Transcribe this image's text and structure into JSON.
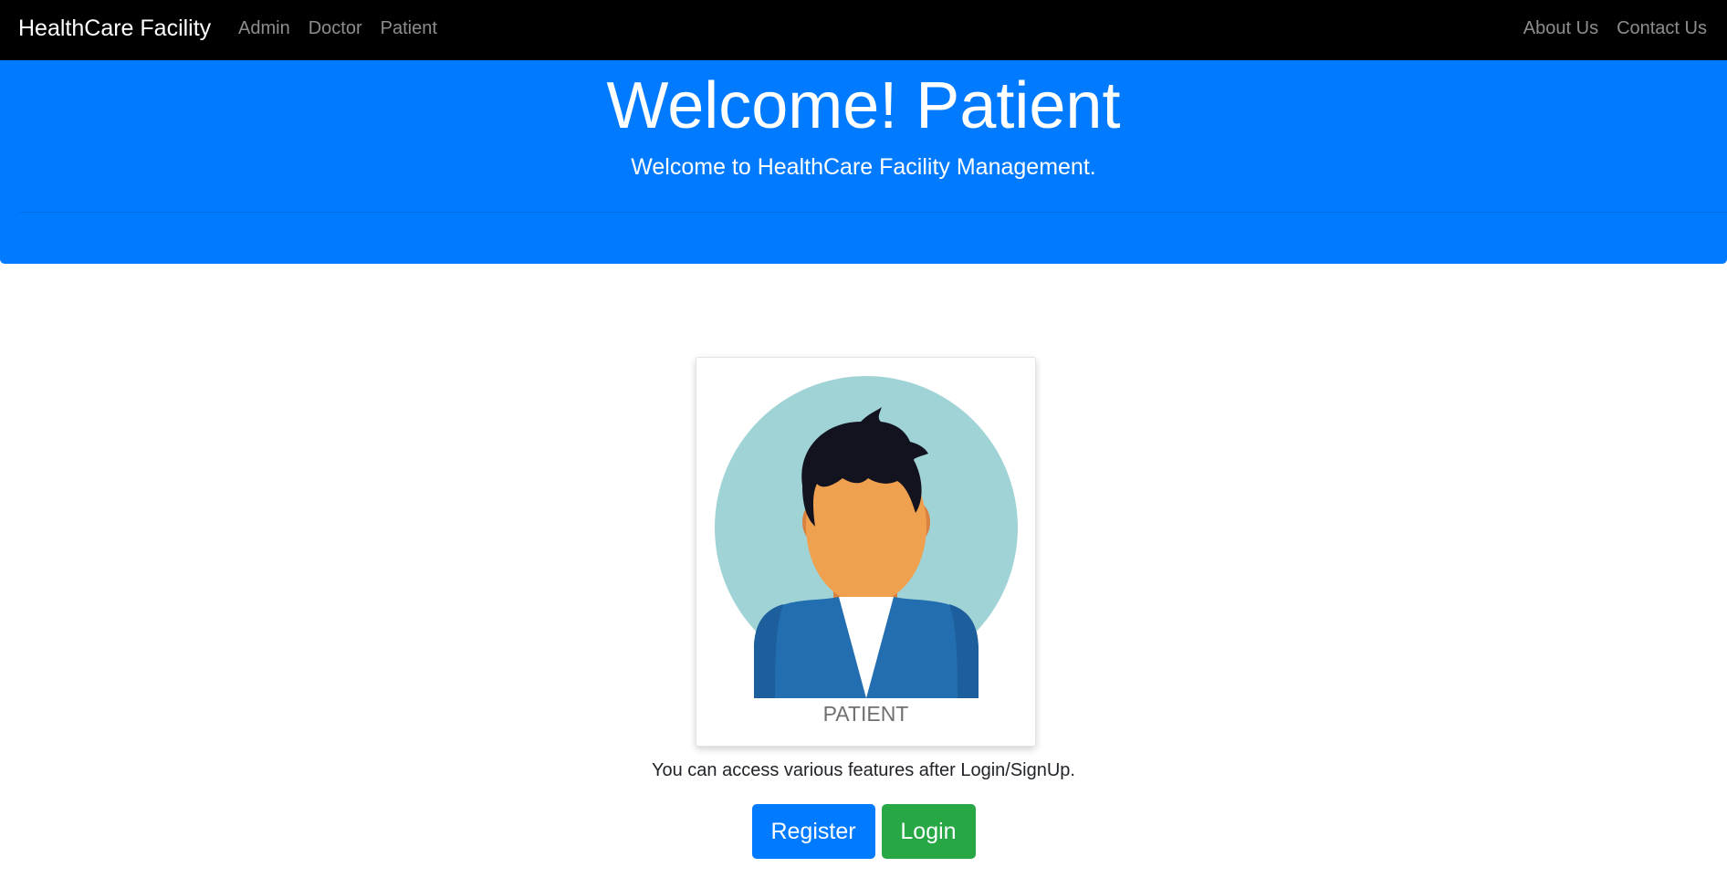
{
  "navbar": {
    "brand": "HealthCare Facility",
    "left_links": [
      "Admin",
      "Doctor",
      "Patient"
    ],
    "right_links": [
      "About Us",
      "Contact Us"
    ]
  },
  "jumbotron": {
    "title": "Welcome! Patient",
    "subtitle": "Welcome to HealthCare Facility Management."
  },
  "card": {
    "image": "patient-avatar-illustration",
    "caption": "PATIENT"
  },
  "info_text": "You can access various features after Login/SignUp.",
  "buttons": {
    "register": "Register",
    "login": "Login"
  },
  "colors": {
    "navbar_bg": "#000000",
    "jumbotron_bg": "#007bff",
    "register_btn": "#007bff",
    "login_btn": "#28a745",
    "avatar_bg": "#a0d3d6",
    "skin": "#f0a14f",
    "hair": "#13131f",
    "jacket": "#226eb0"
  }
}
